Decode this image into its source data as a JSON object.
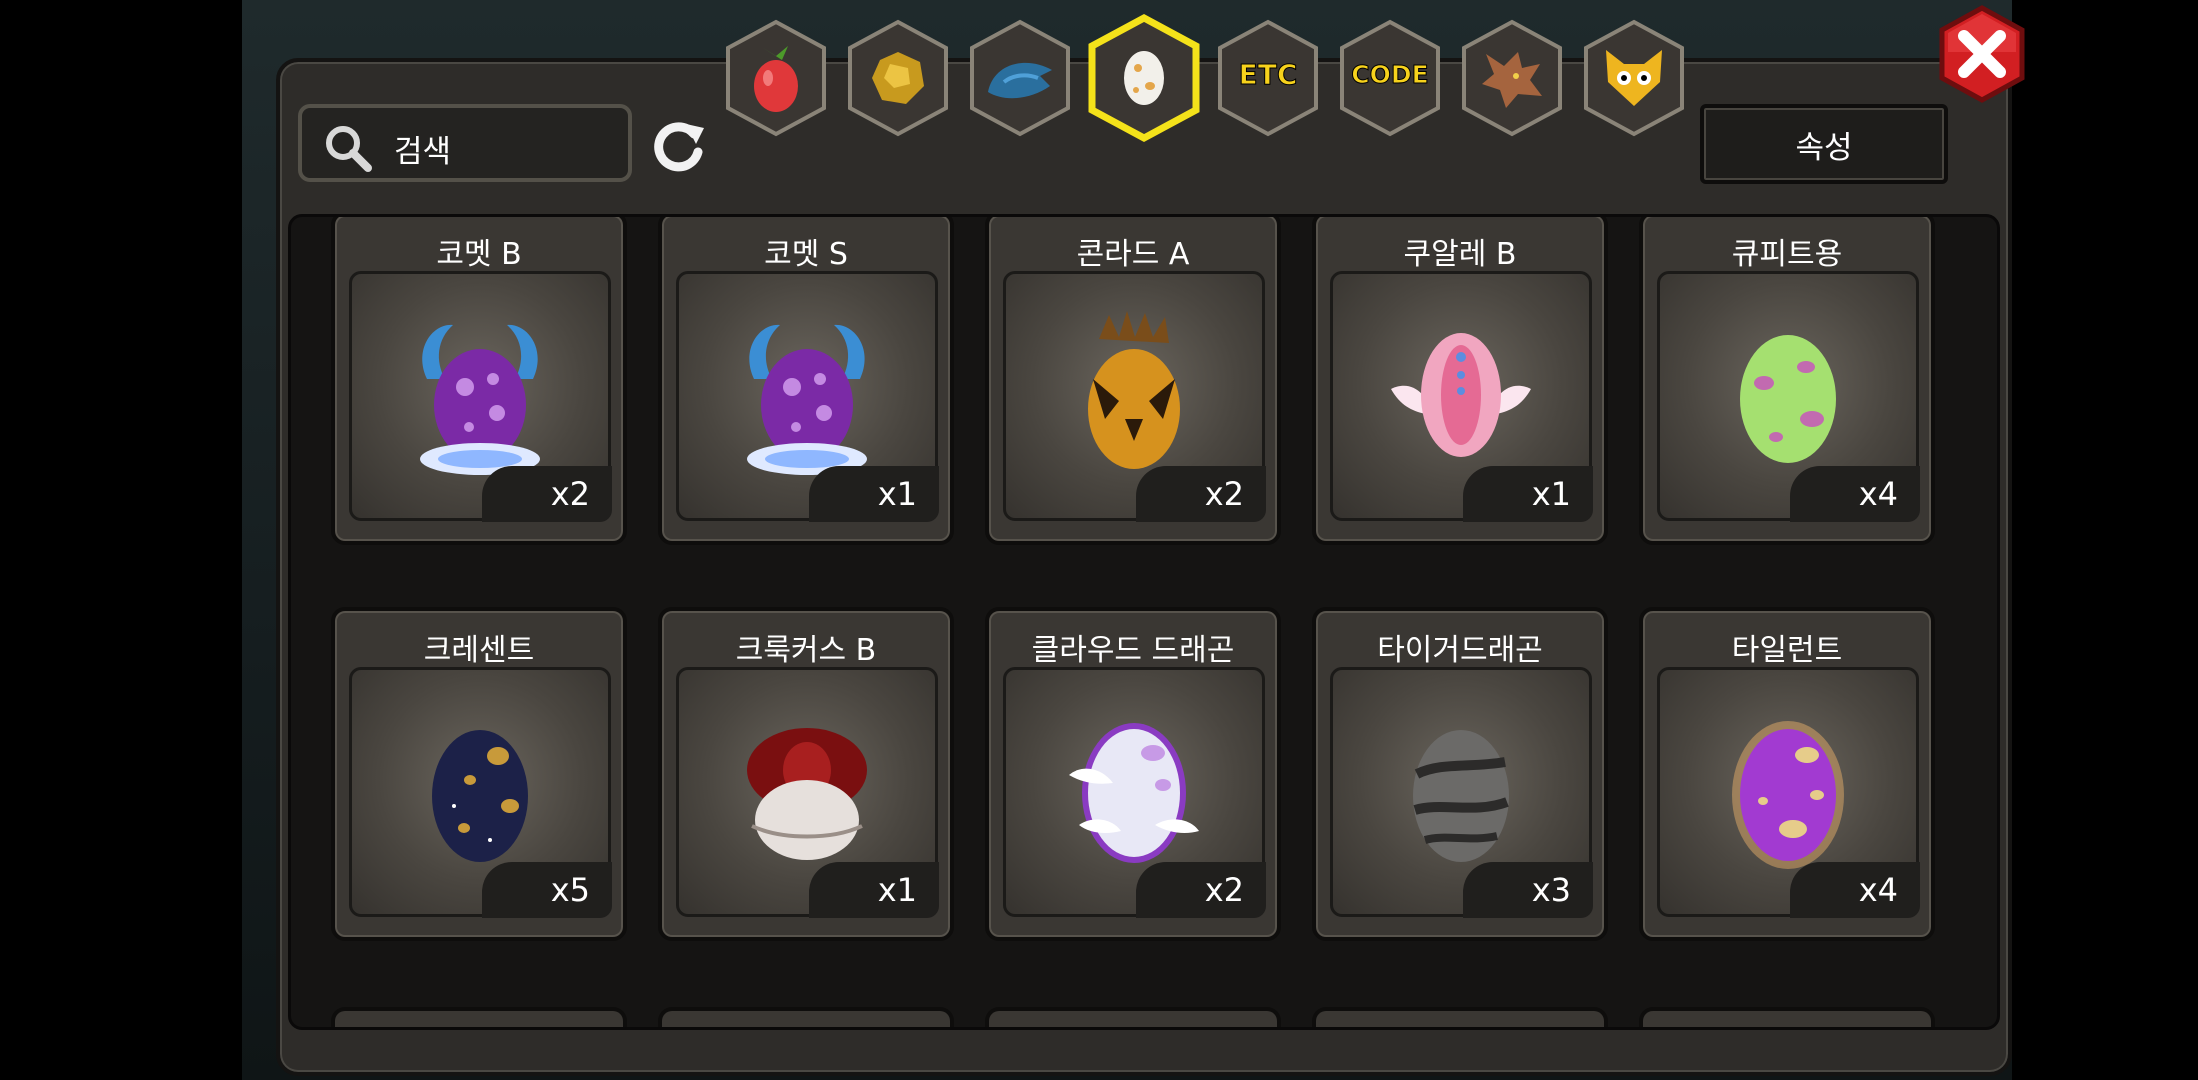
{
  "search": {
    "placeholder": "검색"
  },
  "attribute_button": "속성",
  "tabs": [
    {
      "icon": "fruit-icon",
      "selected": false
    },
    {
      "icon": "gold-nugget-icon",
      "selected": false
    },
    {
      "icon": "blue-creature-icon",
      "selected": false
    },
    {
      "icon": "egg-icon",
      "selected": true
    },
    {
      "icon": "etc-tab",
      "label": "ETC",
      "selected": false
    },
    {
      "icon": "code-tab",
      "label": "CODE",
      "selected": false
    },
    {
      "icon": "dragon-icon",
      "selected": false
    },
    {
      "icon": "cat-face-icon",
      "selected": false
    }
  ],
  "items": [
    {
      "name": "코멧 B",
      "qty": "x2",
      "egg": "purple-horned"
    },
    {
      "name": "코멧 S",
      "qty": "x1",
      "egg": "purple-horned"
    },
    {
      "name": "콘라드 A",
      "qty": "x2",
      "egg": "gold-spiked"
    },
    {
      "name": "쿠알레 B",
      "qty": "x1",
      "egg": "pink-winged"
    },
    {
      "name": "큐피트용",
      "qty": "x4",
      "egg": "green-spotted"
    },
    {
      "name": "크레센트",
      "qty": "x5",
      "egg": "navy-gold"
    },
    {
      "name": "크룩커스 B",
      "qty": "x1",
      "egg": "red-feathered"
    },
    {
      "name": "클라우드 드래곤",
      "qty": "x2",
      "egg": "cloud-lavender"
    },
    {
      "name": "타이거드래곤",
      "qty": "x3",
      "egg": "gray-striped"
    },
    {
      "name": "타일런트",
      "qty": "x4",
      "egg": "magenta-spotted"
    }
  ]
}
